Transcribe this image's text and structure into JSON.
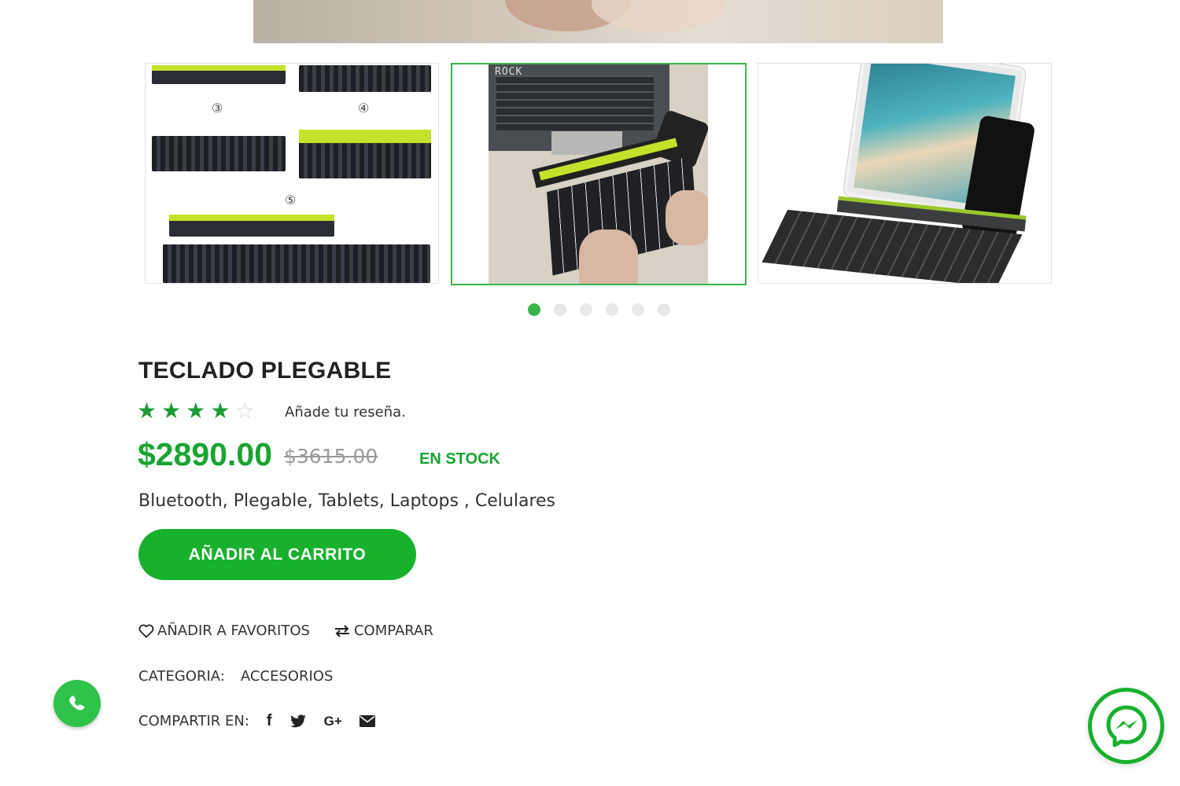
{
  "gallery": {
    "thumb1_numbers": [
      "③",
      "④",
      "⑤"
    ],
    "thumb2_brand": "ROCK",
    "active_thumb": 2,
    "dots_count": 6,
    "active_dot": 1
  },
  "product": {
    "title": "TECLADO PLEGABLE",
    "rating": 4,
    "rating_max": 5,
    "review_link": "Añade tu reseña.",
    "price": "$2890.00",
    "old_price": "$3615.00",
    "stock": "EN STOCK",
    "features": "Bluetooth, Plegable, Tablets, Laptops , Celulares",
    "add_to_cart": "AÑADIR AL CARRITO",
    "wishlist": "AÑADIR A FAVORITOS",
    "compare": "COMPARAR",
    "category_label": "CATEGORIA:",
    "category_value": "ACCESORIOS",
    "share_label": "COMPARTIR EN:",
    "share_icons": [
      "facebook-icon",
      "twitter-icon",
      "google-plus-icon",
      "email-icon"
    ]
  },
  "colors": {
    "accent": "#17b12d",
    "price": "#18a530",
    "star": "#1e9b34",
    "dot_inactive": "#e8e8e8"
  },
  "floating": {
    "whatsapp": "whatsapp-icon",
    "messenger": "messenger-icon"
  }
}
